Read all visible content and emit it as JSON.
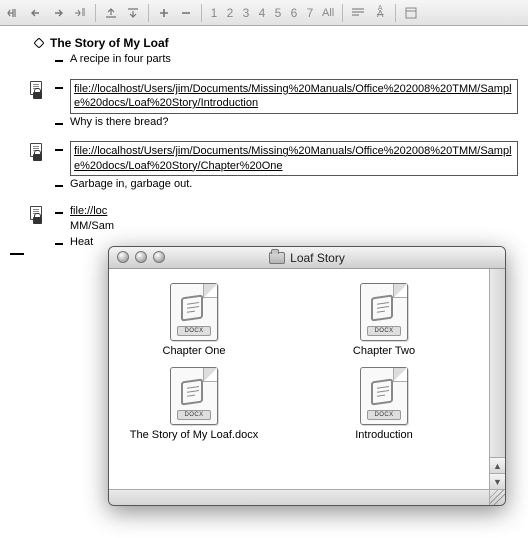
{
  "toolbar": {
    "numbers": [
      "1",
      "2",
      "3",
      "4",
      "5",
      "6",
      "7"
    ],
    "all_label": "All"
  },
  "outline": {
    "title": "The Story of My Loaf",
    "subtitle": "A recipe in four parts",
    "items": [
      {
        "type": "link",
        "text": "file://localhost/Users/jim/Documents/Missing%20Manuals/Office%202008%20TMM/Sample%20docs/Loaf%20Story/Introduction"
      },
      {
        "type": "text",
        "text": "Why is there bread?"
      },
      {
        "type": "link",
        "text": "file://localhost/Users/jim/Documents/Missing%20Manuals/Office%202008%20TMM/Sample%20docs/Loaf%20Story/Chapter%20One"
      },
      {
        "type": "text",
        "text": "Garbage in, garbage out."
      },
      {
        "type": "link_cut",
        "text": "file://loc",
        "text2": "MM/Sam"
      },
      {
        "type": "text",
        "text": "Heat"
      }
    ]
  },
  "finder": {
    "title": "Loaf Story",
    "band": "DOCX",
    "files": [
      "Chapter One",
      "Chapter Two",
      "The Story of My Loaf.docx",
      "Introduction"
    ]
  }
}
